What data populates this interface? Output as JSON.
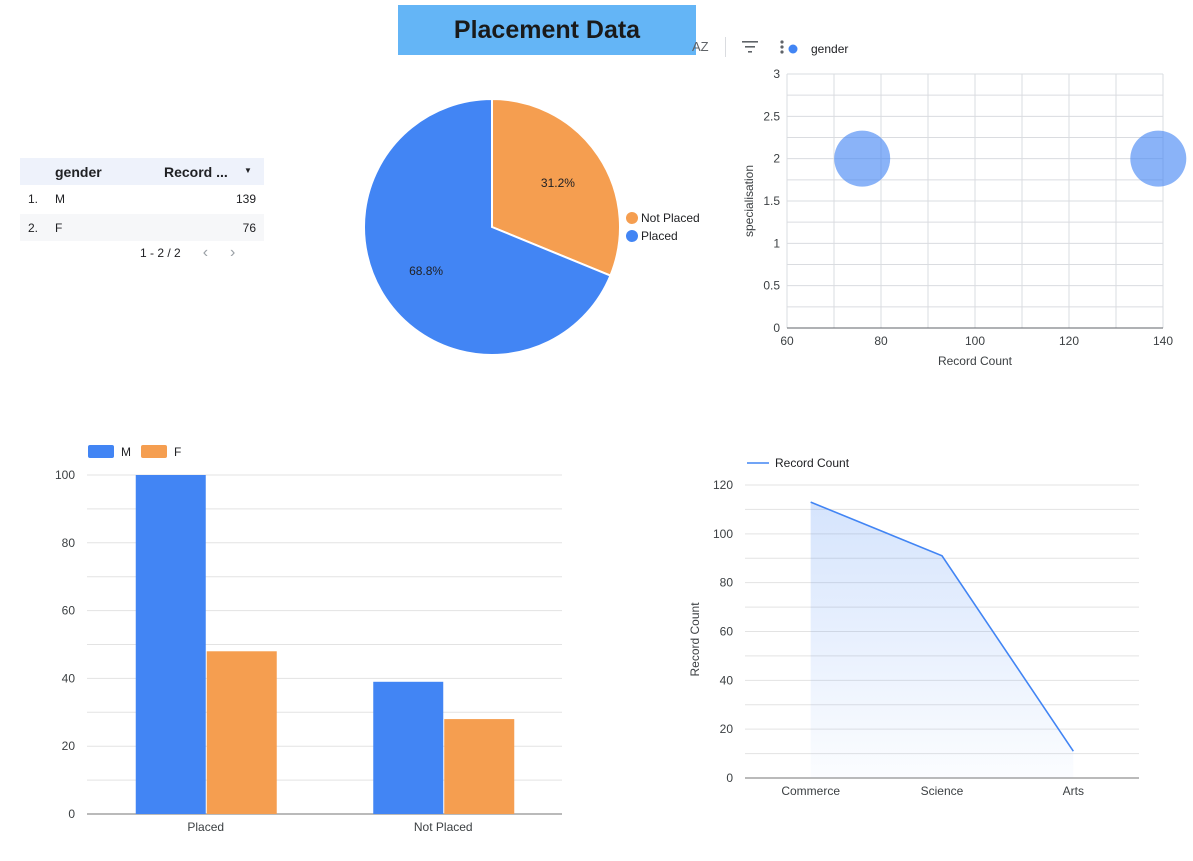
{
  "title": "Placement Data",
  "toolbar": {
    "sort_icon": "AZ",
    "filter_icon": "filter-icon",
    "more_icon": "more-vert-icon"
  },
  "table": {
    "headers": [
      "gender",
      "Record ..."
    ],
    "rows": [
      {
        "index": "1.",
        "gender": "M",
        "count": "139"
      },
      {
        "index": "2.",
        "gender": "F",
        "count": "76"
      }
    ],
    "pagination": "1 - 2 / 2"
  },
  "colors": {
    "blue": "#4285f4",
    "orange": "#f59e50"
  },
  "chart_data": [
    {
      "type": "pie",
      "labels": [
        "Not Placed",
        "Placed"
      ],
      "values": [
        31.2,
        68.8
      ],
      "value_labels": [
        "31.2%",
        "68.8%"
      ],
      "colors": [
        "#f59e50",
        "#4285f4"
      ],
      "legend": "right"
    },
    {
      "type": "scatter",
      "legend_label": "gender",
      "x": [
        76,
        139
      ],
      "y": [
        2,
        2
      ],
      "xlabel": "Record Count",
      "ylabel": "specialisation",
      "xlim": [
        60,
        140
      ],
      "ylim": [
        0,
        3
      ],
      "xticks": [
        "60",
        "80",
        "100",
        "120",
        "140"
      ],
      "yticks": [
        "0",
        "0.5",
        "1",
        "1.5",
        "2",
        "2.5",
        "3"
      ],
      "grid": true
    },
    {
      "type": "bar",
      "categories": [
        "Placed",
        "Not Placed"
      ],
      "series": [
        {
          "name": "M",
          "values": [
            100,
            39
          ]
        },
        {
          "name": "F",
          "values": [
            48,
            28
          ]
        }
      ],
      "ylim": [
        0,
        100
      ],
      "yticks": [
        "0",
        "20",
        "40",
        "60",
        "80",
        "100"
      ],
      "legend": "top-left"
    },
    {
      "type": "area",
      "categories": [
        "Commerce",
        "Science",
        "Arts"
      ],
      "series": [
        {
          "name": "Record Count",
          "values": [
            113,
            91,
            11
          ]
        }
      ],
      "ylabel": "Record Count",
      "ylim": [
        0,
        120
      ],
      "yticks": [
        "0",
        "20",
        "40",
        "60",
        "80",
        "100",
        "120"
      ],
      "legend": "top-left"
    }
  ]
}
